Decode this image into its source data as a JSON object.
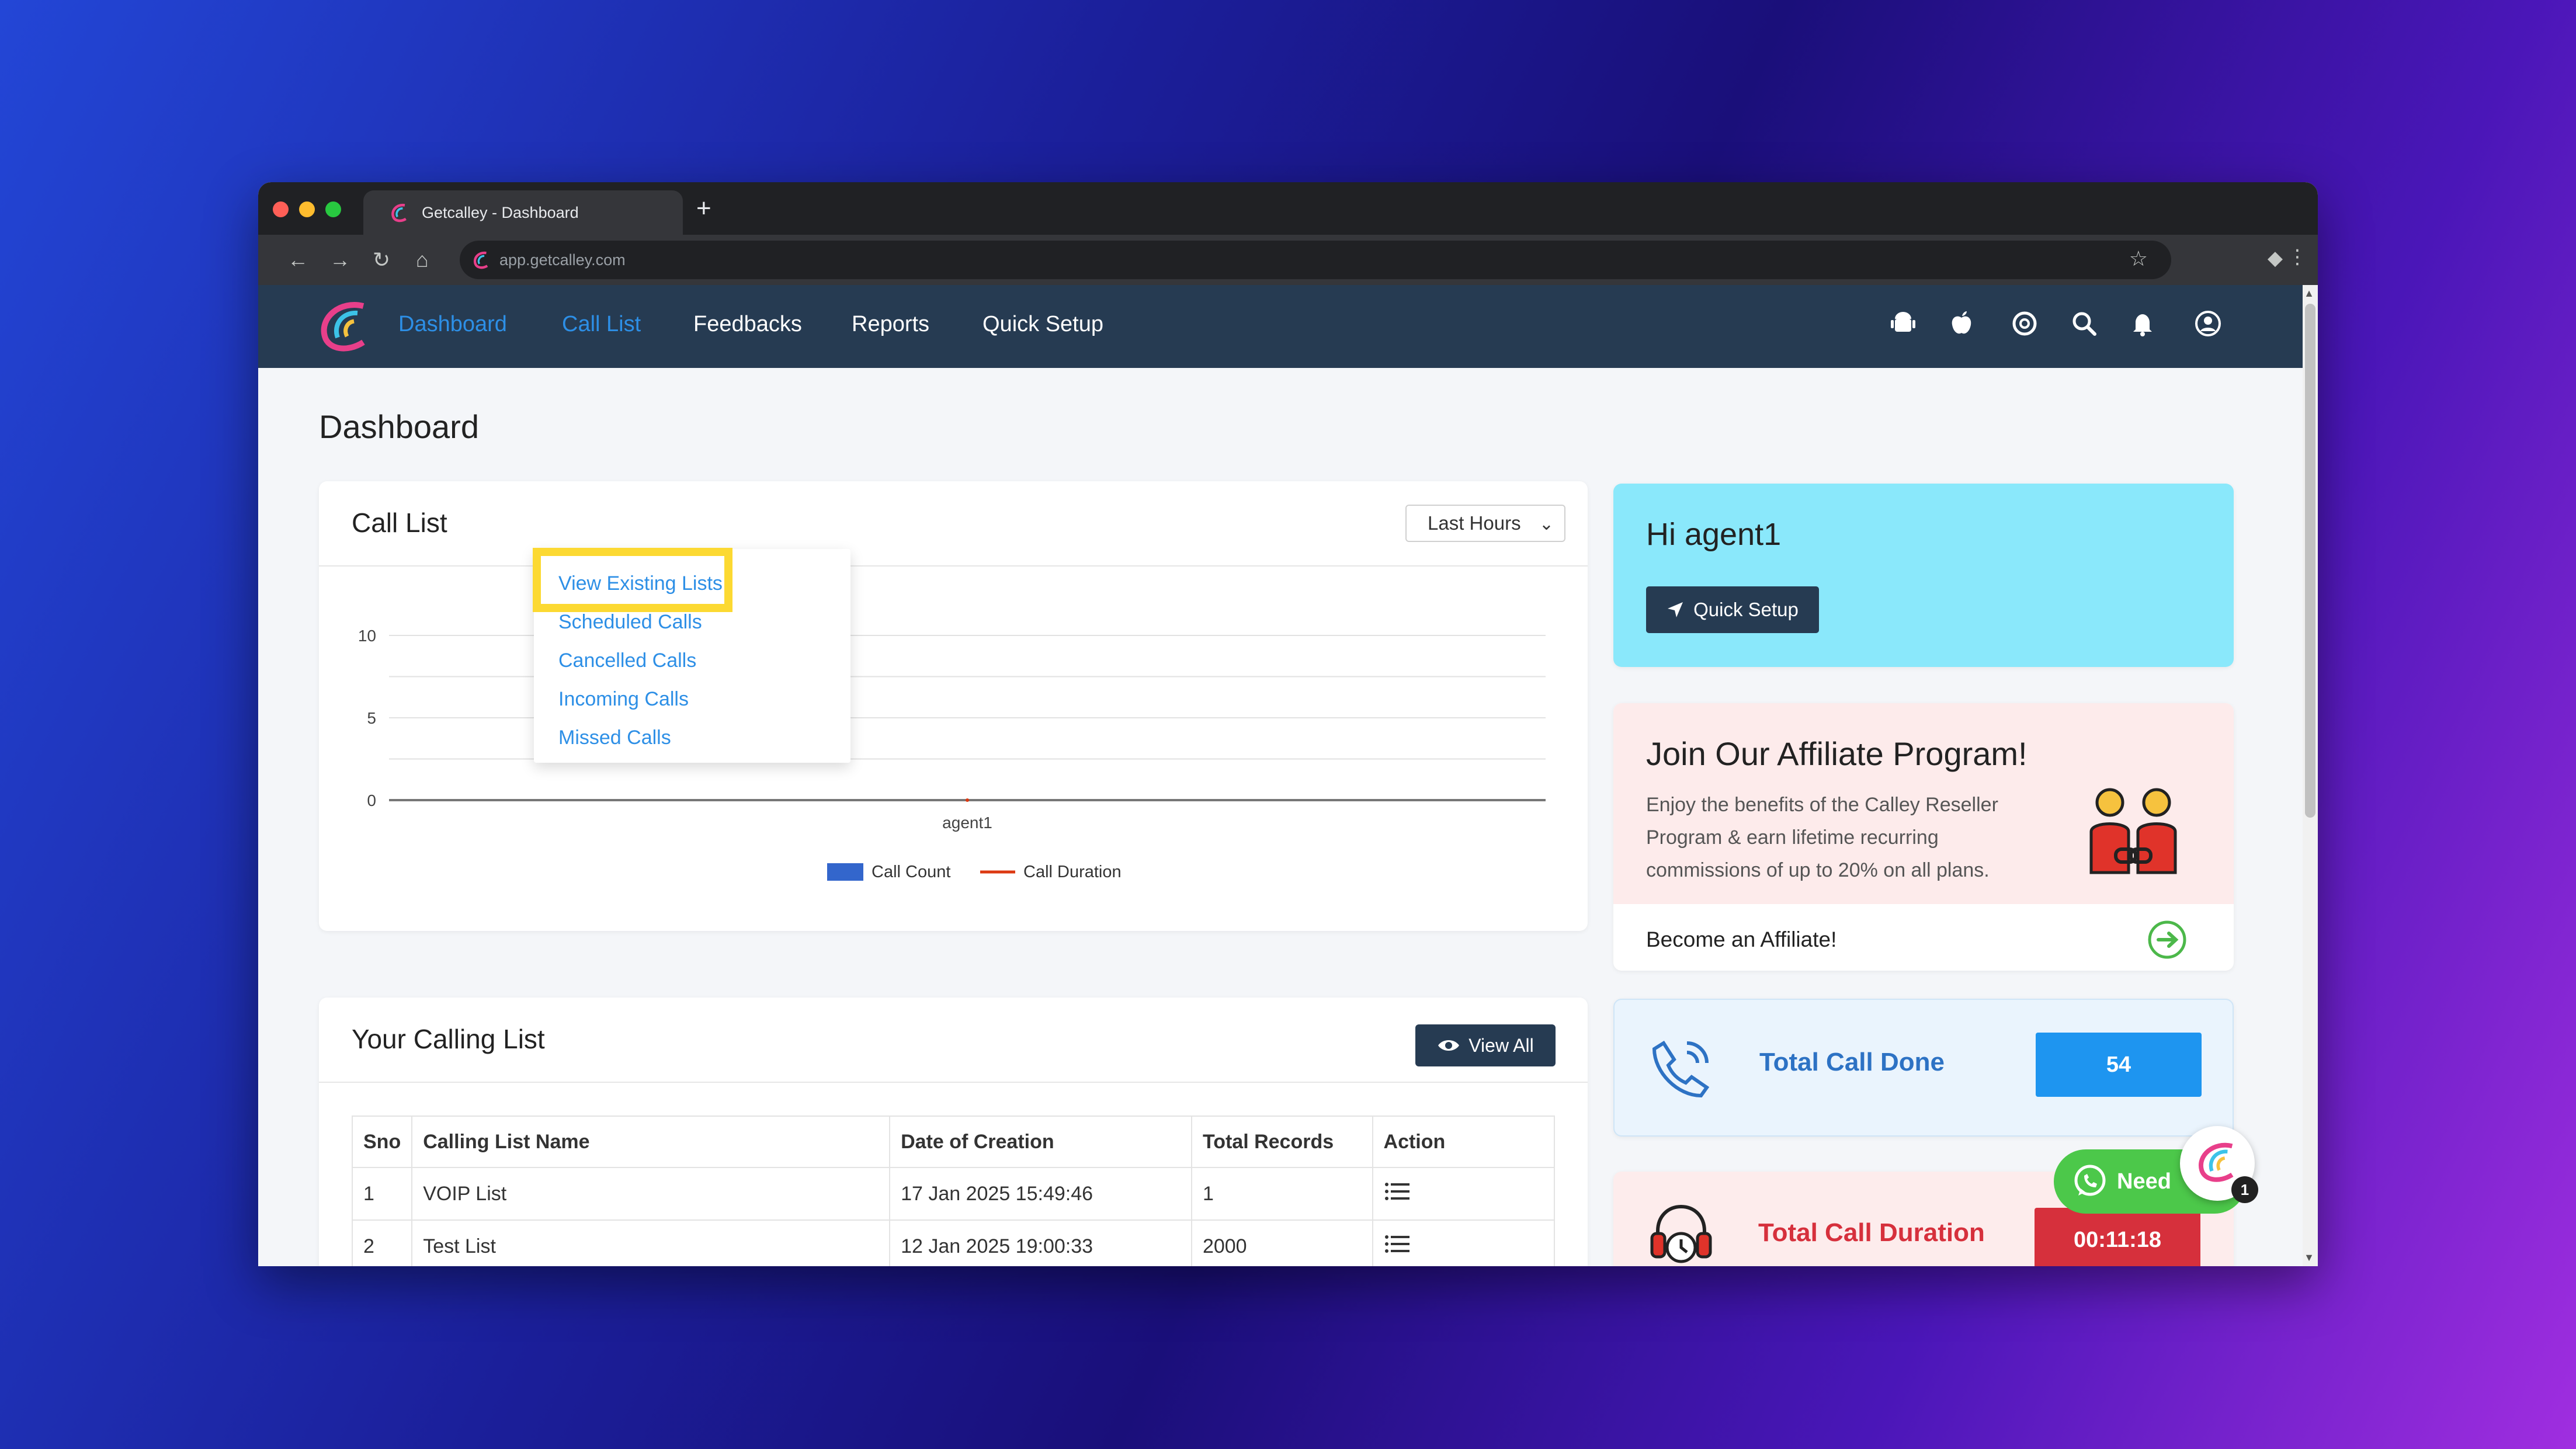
{
  "browser": {
    "tab_title": "Getcalley - Dashboard",
    "new_tab": "+",
    "url": "app.getcalley.com"
  },
  "nav": {
    "items": [
      "Dashboard",
      "Call List",
      "Feedbacks",
      "Reports",
      "Quick Setup"
    ],
    "active": "Dashboard",
    "open_menu": "Call List"
  },
  "dropdown": {
    "items": [
      "View Existing Lists",
      "Scheduled Calls",
      "Cancelled Calls",
      "Incoming Calls",
      "Missed Calls"
    ],
    "highlighted": "View Existing Lists"
  },
  "page_title": "Dashboard",
  "call_list_card": {
    "title": "Call List",
    "select_value": "Last Hours"
  },
  "chart_data": {
    "type": "bar",
    "categories": [
      "agent1"
    ],
    "series": [
      {
        "name": "Call Count",
        "values": [
          0
        ]
      },
      {
        "name": "Call Duration",
        "values": [
          0
        ]
      }
    ],
    "ylim": [
      0,
      10
    ],
    "yticks": [
      "0",
      "5",
      "10"
    ],
    "legend": "bottom",
    "grid": true,
    "colors": {
      "Call Count": "#3366cc",
      "Call Duration": "#dc3912"
    }
  },
  "calling_list": {
    "title": "Your Calling List",
    "view_all": "View All",
    "columns": [
      "Sno",
      "Calling List Name",
      "Date of Creation",
      "Total Records",
      "Action"
    ],
    "rows": [
      [
        "1",
        "VOIP List",
        "17 Jan 2025 15:49:46",
        "1",
        "list-icon"
      ],
      [
        "2",
        "Test List",
        "12 Jan 2025 19:00:33",
        "2000",
        "list-icon"
      ]
    ]
  },
  "hi_card": {
    "greeting": "Hi agent1",
    "button": "Quick Setup"
  },
  "affiliate": {
    "title": "Join Our Affiliate Program!",
    "body": "Enjoy the benefits of the Calley Reseller Program & earn lifetime recurring commissions of up to 20% on all plans.",
    "link": "Become an Affiliate!"
  },
  "stats": {
    "calls_label": "Total Call Done",
    "calls_value": "54",
    "duration_label": "Total Call Duration",
    "duration_value": "00:11:18"
  },
  "chat": {
    "whatsapp_label": "Need",
    "badge": "1"
  },
  "colors": {
    "navbar": "#263b52",
    "accent": "#2d8fe6",
    "highlight": "#fcd932",
    "hi_card": "#8ae8fb",
    "stat_blue": "#1e95f0",
    "stat_red": "#d6303c"
  }
}
